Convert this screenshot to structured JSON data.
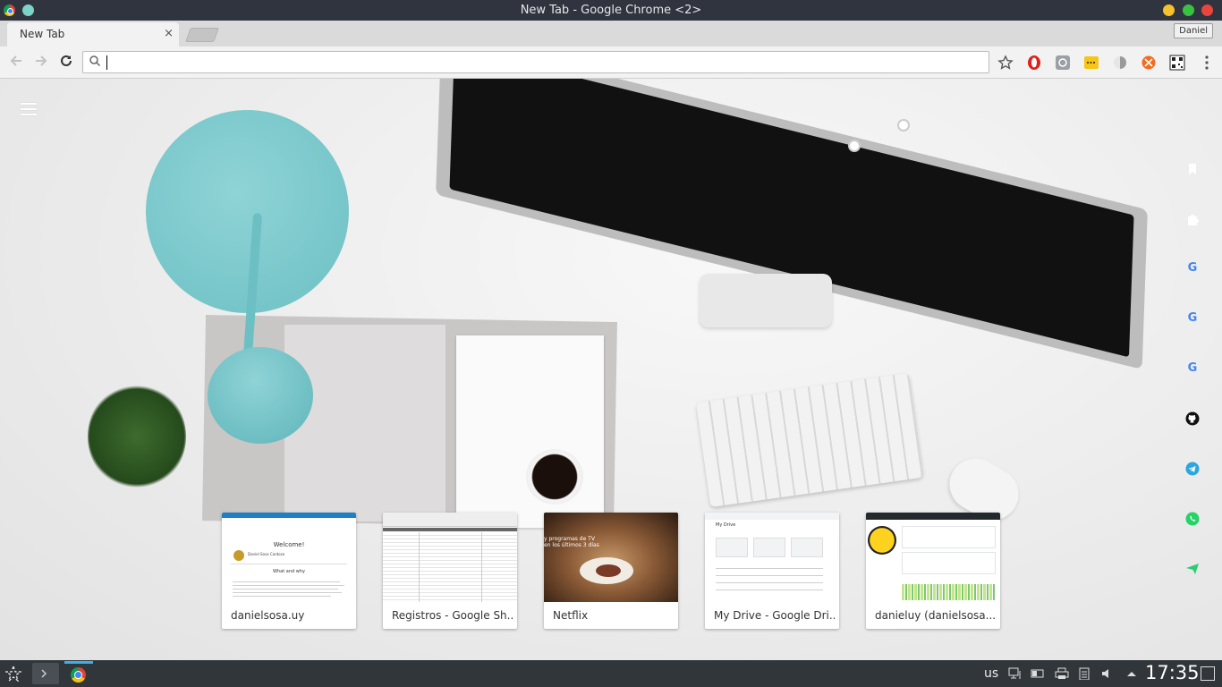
{
  "window": {
    "title": "New Tab - Google Chrome <2>",
    "icon": "chrome-icon",
    "controls": [
      "minimize",
      "maximize",
      "close"
    ],
    "control_colors": {
      "minimize": "#f6c12a",
      "maximize": "#39c241",
      "close": "#e8463c"
    }
  },
  "tabs": [
    {
      "label": "New Tab",
      "active": true,
      "close_glyph": "×"
    }
  ],
  "profile": {
    "name": "Daniel"
  },
  "toolbar": {
    "omnibox": {
      "value": "",
      "placeholder": ""
    },
    "extensions": [
      "opera-icon",
      "atom-icon",
      "yellow-notes-icon",
      "shade-icon",
      "orange-extension-icon",
      "qr-code-icon"
    ]
  },
  "new_tab_page": {
    "menu_icon": "hamburger-icon",
    "side_shortcuts": [
      {
        "icon": "bookmark-icon",
        "glyph": ""
      },
      {
        "icon": "puzzle-icon",
        "glyph": ""
      },
      {
        "icon": "google-icon",
        "glyph": "G"
      },
      {
        "icon": "google-icon",
        "glyph": "G"
      },
      {
        "icon": "google-icon",
        "glyph": "G"
      },
      {
        "icon": "github-icon",
        "glyph": ""
      },
      {
        "icon": "telegram-icon",
        "glyph": ""
      },
      {
        "icon": "whatsapp-icon",
        "glyph": ""
      },
      {
        "icon": "send-icon",
        "glyph": ""
      }
    ],
    "most_visited": [
      {
        "title": "danielsosa.uy",
        "thumb_heading": "Welcome!",
        "thumb_subheading": "What and why",
        "thumb_name": "Daniel Sosa Cardozo"
      },
      {
        "title": "Registros - Google Sh..."
      },
      {
        "title": "Netflix",
        "thumb_text_1": "y programas de TV",
        "thumb_text_2": "en los últimos 3 días"
      },
      {
        "title": "My Drive - Google Dri...",
        "thumb_heading": "My Drive"
      },
      {
        "title": "danieluy (danielsosa..."
      }
    ]
  },
  "taskbar": {
    "keyboard_layout": "us",
    "clock": "17:35",
    "accent": "#3daee9"
  }
}
